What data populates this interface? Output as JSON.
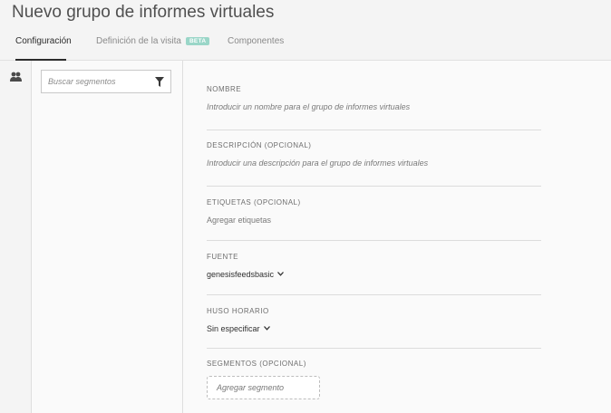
{
  "page": {
    "title": "Nuevo grupo de informes virtuales"
  },
  "tabs": [
    {
      "label": "Configuración",
      "active": true
    },
    {
      "label": "Definición de la visita",
      "badge": "BETA",
      "active": false
    },
    {
      "label": "Componentes",
      "active": false
    }
  ],
  "rail": {
    "icon": "people-icon"
  },
  "segments_panel": {
    "search_placeholder": "Buscar segmentos",
    "filter_icon": "filter-icon"
  },
  "form": {
    "name": {
      "label": "NOMBRE",
      "placeholder": "Introducir un nombre para el grupo de informes virtuales"
    },
    "description": {
      "label": "DESCRIPCIÓN (OPCIONAL)",
      "placeholder": "Introducir una descripción para el grupo de informes virtuales"
    },
    "tags": {
      "label": "ETIQUETAS (OPCIONAL)",
      "action": "Agregar etiquetas"
    },
    "source": {
      "label": "FUENTE",
      "value": "genesisfeedsbasic"
    },
    "timezone": {
      "label": "HUSO HORARIO",
      "value": "Sin especificar"
    },
    "segments": {
      "label": "SEGMENTOS (OPCIONAL)",
      "button": "Agregar segmento"
    }
  },
  "colors": {
    "badge": "#9ad6c8",
    "active_tab": "#2c2c2c",
    "background": "#f4f4f4",
    "panel": "#fafafa"
  }
}
